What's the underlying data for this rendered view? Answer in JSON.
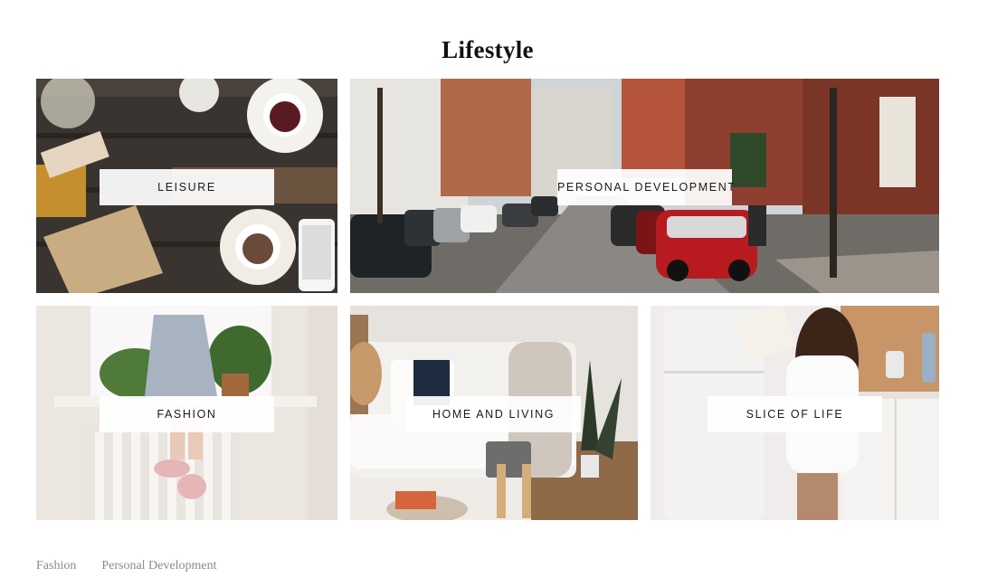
{
  "page": {
    "title": "Lifestyle"
  },
  "tiles": [
    {
      "id": "leisure",
      "label": "LEISURE"
    },
    {
      "id": "personal",
      "label": "PERSONAL DEVELOPMENT"
    },
    {
      "id": "fashion",
      "label": "FASHION"
    },
    {
      "id": "home",
      "label": "HOME AND LIVING"
    },
    {
      "id": "slice",
      "label": "SLICE OF LIFE"
    }
  ],
  "footer": {
    "links": [
      "Fashion",
      "Personal Development"
    ]
  },
  "colors": {
    "title": "#111111",
    "footer_link": "#8a8a8a",
    "label_bg": "#ffffff"
  }
}
